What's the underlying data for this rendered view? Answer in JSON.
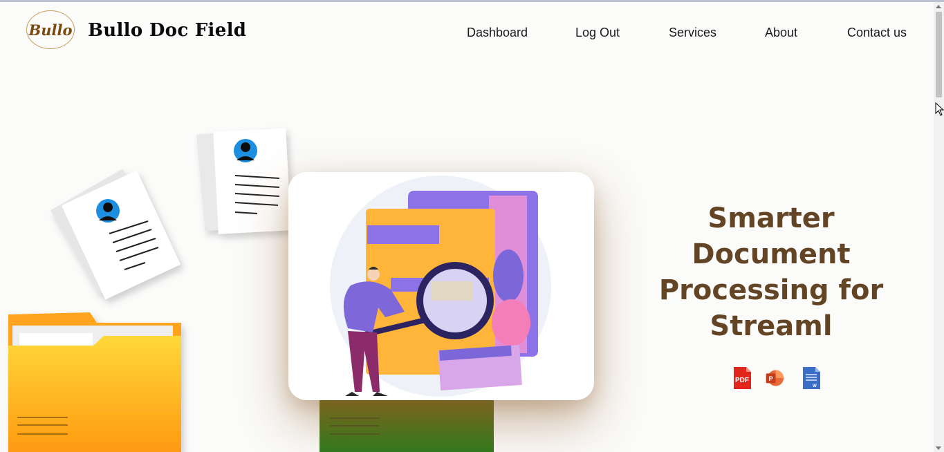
{
  "header": {
    "logo_text": "Bullo",
    "brand": "Bullo Doc Field",
    "nav": [
      {
        "label": "Dashboard"
      },
      {
        "label": "Log Out"
      },
      {
        "label": "Services"
      },
      {
        "label": "About"
      },
      {
        "label": "Contact us"
      }
    ]
  },
  "hero": {
    "headline": [
      "Smarter",
      "Document",
      "Processing for",
      "Streaml"
    ],
    "file_icons": [
      {
        "name": "pdf-icon",
        "label": "PDF",
        "color": "#e3261b"
      },
      {
        "name": "powerpoint-icon",
        "label": "P",
        "color": "#d24726"
      },
      {
        "name": "word-icon",
        "label": "W",
        "color": "#3b6fc7"
      }
    ]
  },
  "colors": {
    "headline": "#634525",
    "logo_ring": "#c79b57",
    "folder_orange": "#ffa41a",
    "folder_green": "#3b6f21",
    "accent_purple": "#8e73e8"
  }
}
